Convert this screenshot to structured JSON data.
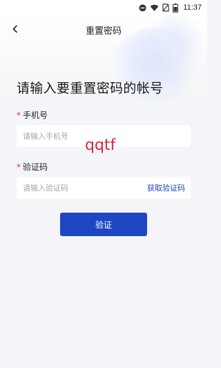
{
  "statusbar": {
    "time": "11:37",
    "battery_level": 0.6
  },
  "header": {
    "title": "重置密码"
  },
  "main": {
    "heading": "请输入要重置密码的帐号",
    "phone": {
      "required_mark": "*",
      "label": "手机号",
      "placeholder": "请输入手机号",
      "value": ""
    },
    "code": {
      "required_mark": "*",
      "label": "验证码",
      "placeholder": "请输入验证码",
      "value": "",
      "get_code_label": "获取验证码"
    },
    "overlay_text": "qqtf",
    "submit_label": "验证"
  },
  "colors": {
    "accent": "#1f47c4",
    "required": "#d9363e",
    "background": "#f4f5f8"
  }
}
